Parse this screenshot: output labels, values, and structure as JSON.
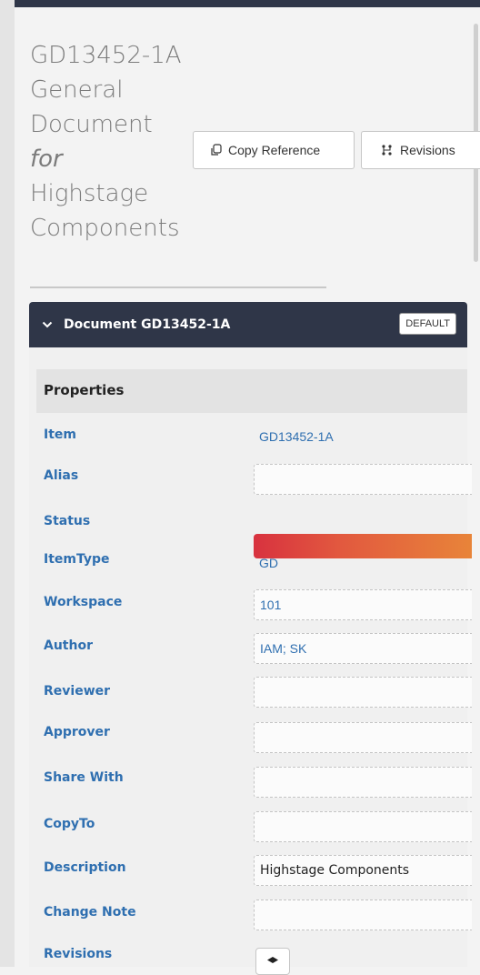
{
  "title": {
    "line1": "GD13452-1A",
    "line2": "General",
    "line3": "Document",
    "line4": "for",
    "line5": "Highstage",
    "line6": "Components"
  },
  "toolbar": {
    "copy_reference_label": "Copy Reference",
    "revisions_label": "Revisions"
  },
  "panel": {
    "title": "Document GD13452-1A",
    "badge": "DEFAULT",
    "section_title": "Properties"
  },
  "properties": [
    {
      "label": "Item",
      "value": "GD13452-1A"
    },
    {
      "label": "Alias",
      "value": ""
    },
    {
      "label": "Status",
      "value": ""
    },
    {
      "label": "ItemType",
      "value": "GD"
    },
    {
      "label": "Workspace",
      "value": "101"
    },
    {
      "label": "Author",
      "value": "IAM; SK"
    },
    {
      "label": "Reviewer",
      "value": ""
    },
    {
      "label": "Approver",
      "value": ""
    },
    {
      "label": "Share With",
      "value": ""
    },
    {
      "label": "CopyTo",
      "value": ""
    },
    {
      "label": "Description",
      "value": "Highstage Components"
    },
    {
      "label": "Change Note",
      "value": ""
    },
    {
      "label": "Revisions",
      "value": ""
    }
  ],
  "colors": {
    "header_bg": "#2f3648",
    "label_blue": "#2f6fb0",
    "status_gradient_start": "#d8323f",
    "status_gradient_end": "#e88439"
  }
}
